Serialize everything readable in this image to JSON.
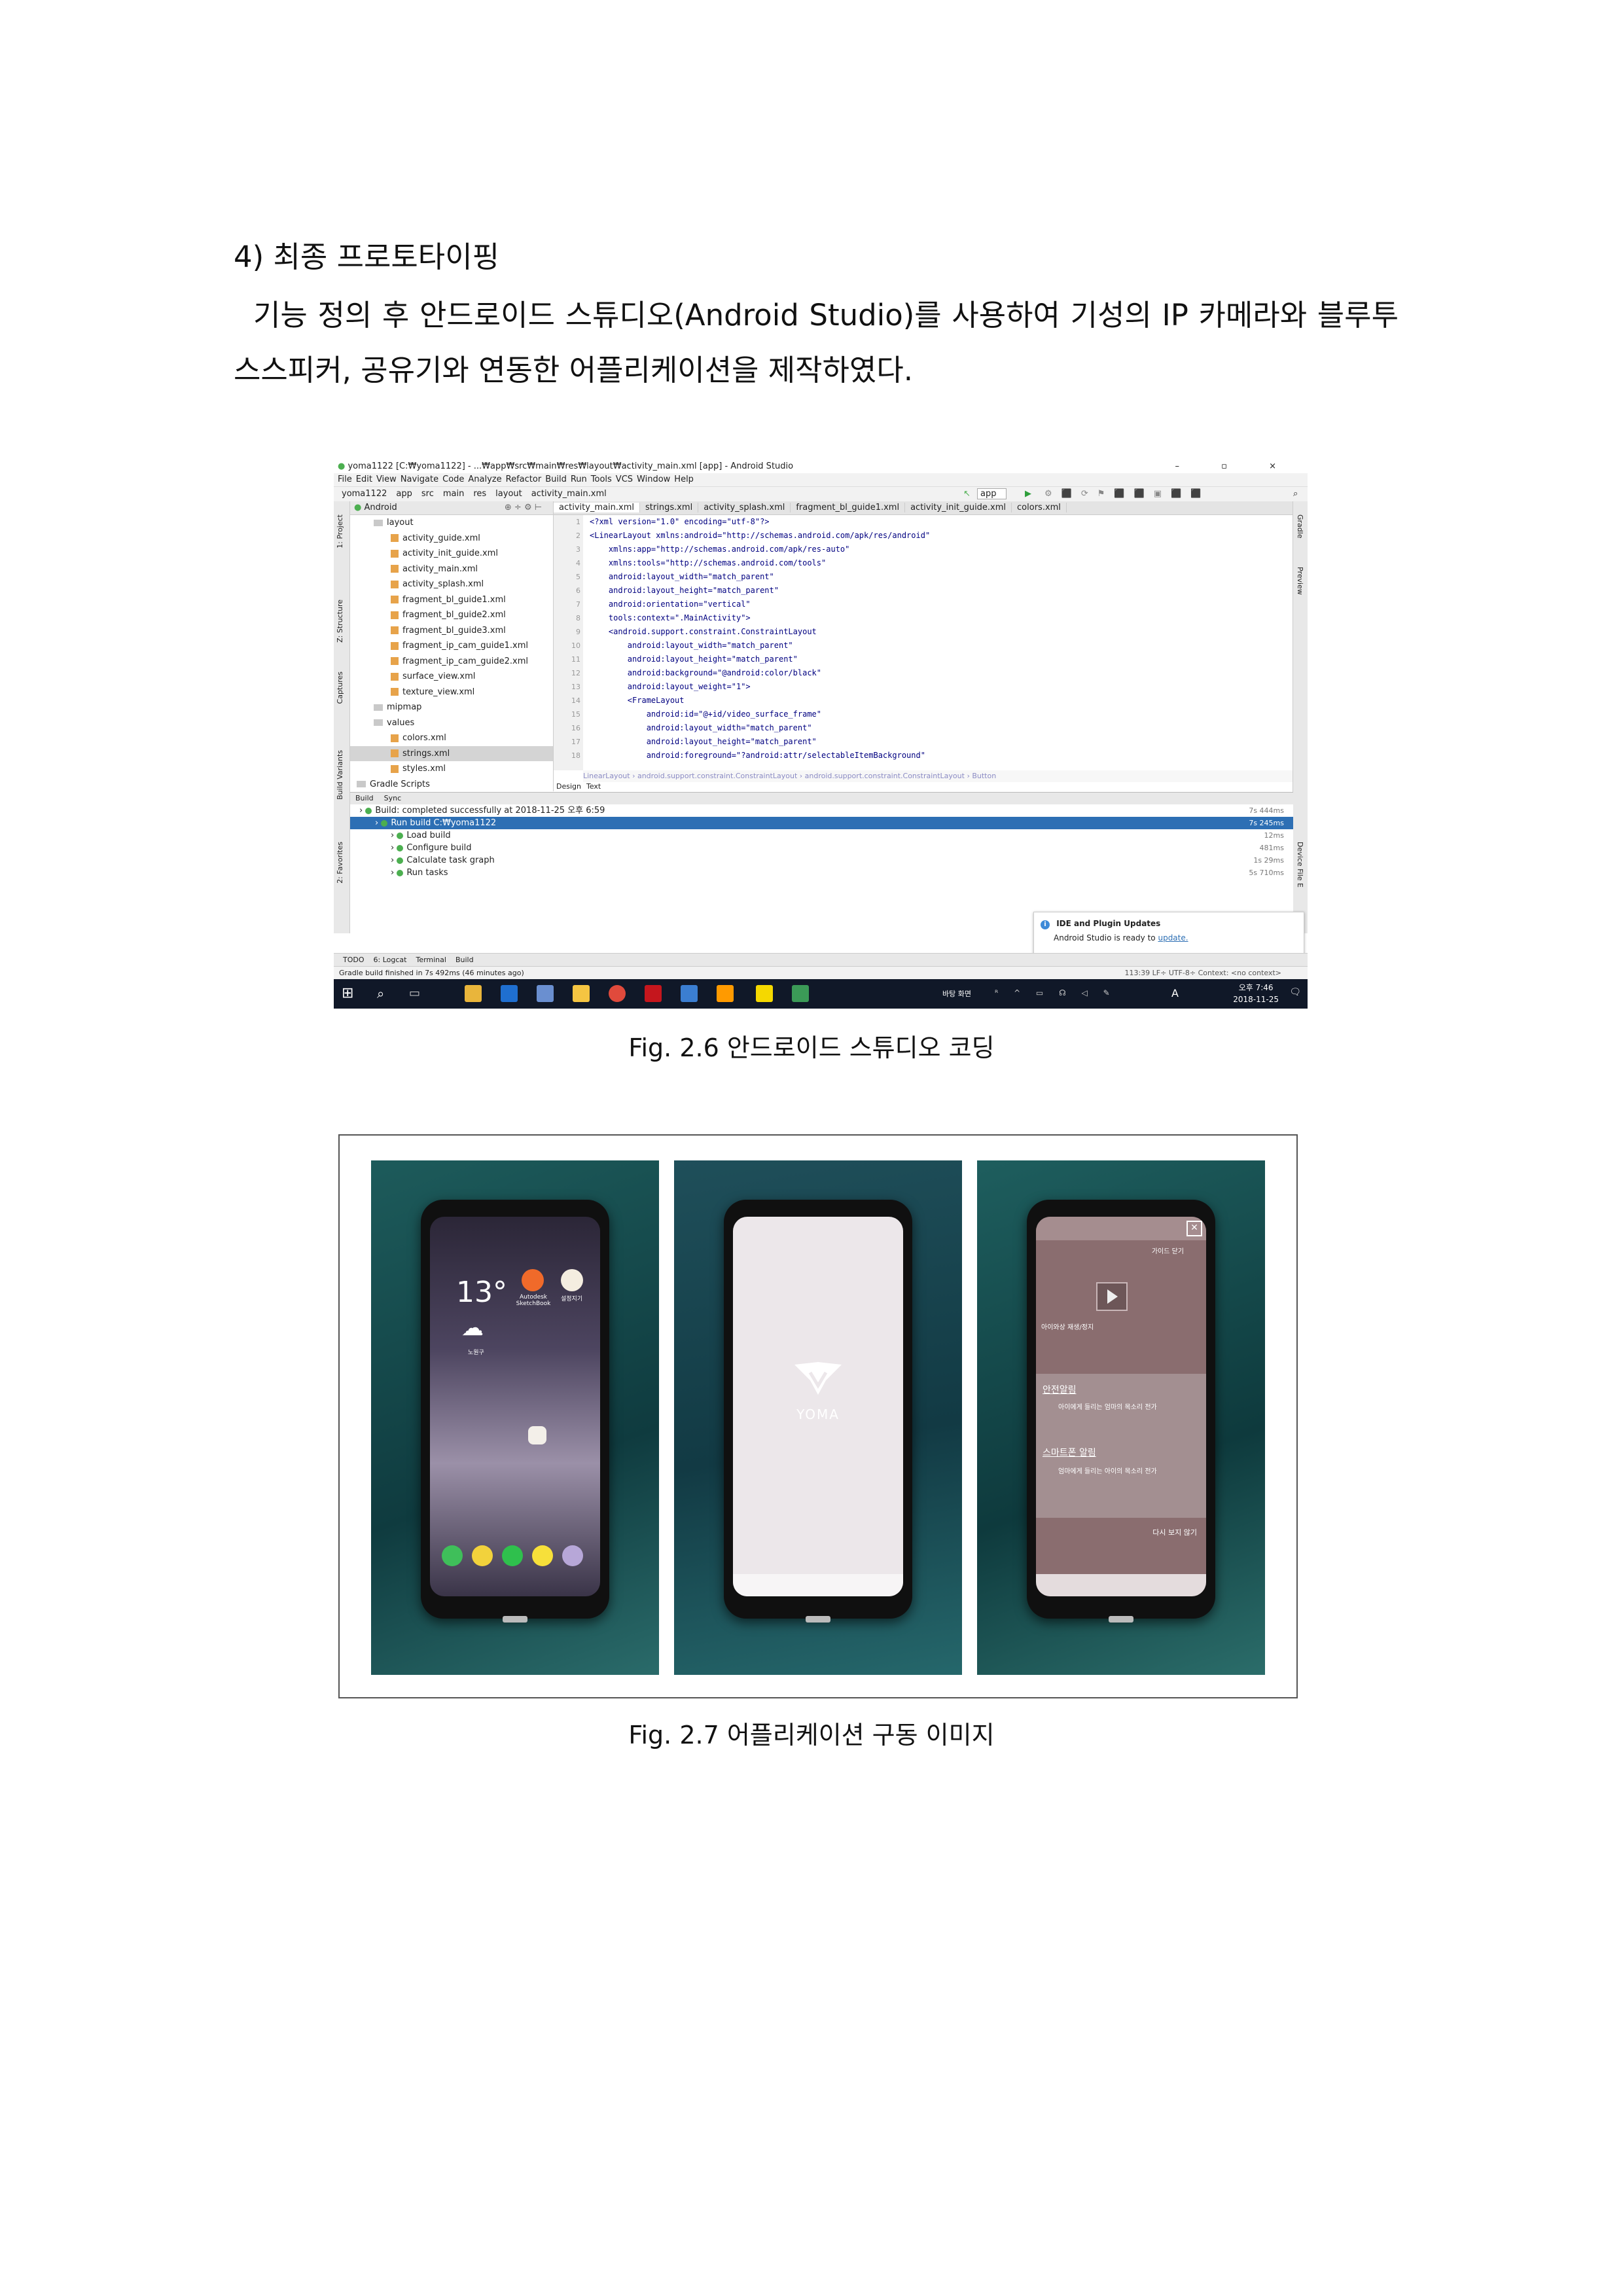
{
  "doc": {
    "heading": "4) 최종 프로토타이핑",
    "paragraph": "기능 정의 후 안드로이드 스튜디오(Android Studio)를 사용하여 기성의 IP 카메라와 블루투스스피커, 공유기와 연동한 어플리케이션을 제작하였다.",
    "fig1_caption": "Fig. 2.6 안드로이드 스튜디오 코딩",
    "fig2_caption": "Fig. 2.7 어플리케이션 구동 이미지"
  },
  "studio": {
    "title": "yoma1122 [C:₩yoma1122] - ...₩app₩src₩main₩res₩layout₩activity_main.xml [app] - Android Studio",
    "window_controls": "–  ▫  ×",
    "menu": [
      "File",
      "Edit",
      "View",
      "Navigate",
      "Code",
      "Analyze",
      "Refactor",
      "Build",
      "Run",
      "Tools",
      "VCS",
      "Window",
      "Help"
    ],
    "nav": [
      "yoma1122",
      "app",
      "src",
      "main",
      "res",
      "layout",
      "activity_main.xml"
    ],
    "run_config": "app",
    "project_view": "Android",
    "left_tools": [
      "1: Project",
      "Z: Structure",
      "Captures",
      "Build Variants",
      "2: Favorites"
    ],
    "right_tools": [
      "Gradle",
      "Preview",
      "Device File E"
    ],
    "tree": [
      {
        "label": "layout",
        "type": "folder",
        "indent": 1
      },
      {
        "label": "activity_guide.xml",
        "type": "file",
        "indent": 2
      },
      {
        "label": "activity_init_guide.xml",
        "type": "file",
        "indent": 2
      },
      {
        "label": "activity_main.xml",
        "type": "file",
        "indent": 2
      },
      {
        "label": "activity_splash.xml",
        "type": "file",
        "indent": 2
      },
      {
        "label": "fragment_bl_guide1.xml",
        "type": "file",
        "indent": 2
      },
      {
        "label": "fragment_bl_guide2.xml",
        "type": "file",
        "indent": 2
      },
      {
        "label": "fragment_bl_guide3.xml",
        "type": "file",
        "indent": 2
      },
      {
        "label": "fragment_ip_cam_guide1.xml",
        "type": "file",
        "indent": 2
      },
      {
        "label": "fragment_ip_cam_guide2.xml",
        "type": "file",
        "indent": 2
      },
      {
        "label": "surface_view.xml",
        "type": "file",
        "indent": 2
      },
      {
        "label": "texture_view.xml",
        "type": "file",
        "indent": 2
      },
      {
        "label": "mipmap",
        "type": "folder",
        "indent": 1
      },
      {
        "label": "values",
        "type": "folder",
        "indent": 1
      },
      {
        "label": "colors.xml",
        "type": "file",
        "indent": 2
      },
      {
        "label": "strings.xml",
        "type": "file",
        "indent": 2,
        "selected": true
      },
      {
        "label": "styles.xml",
        "type": "file",
        "indent": 2
      },
      {
        "label": "Gradle Scripts",
        "type": "folder",
        "indent": 0
      }
    ],
    "tabs": [
      "activity_main.xml",
      "strings.xml",
      "activity_splash.xml",
      "fragment_bl_guide1.xml",
      "activity_init_guide.xml",
      "colors.xml"
    ],
    "code": [
      {
        "t": "<?xml version=\"1.0\" encoding=\"utf-8\"?>"
      },
      {
        "t": "<LinearLayout xmlns:android=\"http://schemas.android.com/apk/res/android\""
      },
      {
        "t": "    xmlns:app=\"http://schemas.android.com/apk/res-auto\""
      },
      {
        "t": "    xmlns:tools=\"http://schemas.android.com/tools\""
      },
      {
        "t": "    android:layout_width=\"match_parent\""
      },
      {
        "t": "    android:layout_height=\"match_parent\""
      },
      {
        "t": "    android:orientation=\"vertical\""
      },
      {
        "t": "    tools:context=\".MainActivity\">"
      },
      {
        "t": "    <android.support.constraint.ConstraintLayout"
      },
      {
        "t": "        android:layout_width=\"match_parent\""
      },
      {
        "t": "        android:layout_height=\"match_parent\""
      },
      {
        "t": "        android:background=\"@android:color/black\""
      },
      {
        "t": "        android:layout_weight=\"1\">"
      },
      {
        "t": "        <FrameLayout"
      },
      {
        "t": "            android:id=\"@+id/video_surface_frame\""
      },
      {
        "t": "            android:layout_width=\"match_parent\""
      },
      {
        "t": "            android:layout_height=\"match_parent\""
      },
      {
        "t": "            android:foreground=\"?android:attr/selectableItemBackground\""
      }
    ],
    "line_numbers": [
      "1",
      "2",
      "3",
      "4",
      "5",
      "6",
      "7",
      "8",
      "9",
      "10",
      "11",
      "12",
      "13",
      "14",
      "15",
      "16",
      "17",
      "18"
    ],
    "breadcrumb": "LinearLayout  ›  android.support.constraint.ConstraintLayout  ›  android.support.constraint.ConstraintLayout  ›  Button",
    "design_tabs": [
      "Design",
      "Text"
    ],
    "build_tabs": [
      "Build",
      "Sync"
    ],
    "build_lines": [
      {
        "label": "Build: completed successfully   at 2018-11-25 오후 6:59",
        "time": "7s 444ms",
        "indent": 0,
        "sel": false
      },
      {
        "label": "Run build  C:₩yoma1122",
        "time": "7s 245ms",
        "indent": 1,
        "sel": true
      },
      {
        "label": "Load build",
        "time": "12ms",
        "indent": 2,
        "sel": false
      },
      {
        "label": "Configure build",
        "time": "481ms",
        "indent": 2,
        "sel": false
      },
      {
        "label": "Calculate task graph",
        "time": "1s 29ms",
        "indent": 2,
        "sel": false
      },
      {
        "label": "Run tasks",
        "time": "5s 710ms",
        "indent": 2,
        "sel": false
      }
    ],
    "popup_title": "IDE and Plugin Updates",
    "popup_text": "Android Studio is ready to",
    "popup_link": "update.",
    "tool_windows": [
      "TODO",
      "6: Logcat",
      "Terminal",
      "Build"
    ],
    "status_left": "Gradle build finished in 7s 492ms (46 minutes ago)",
    "status_right": "113:39  LF÷  UTF-8÷  Context: <no context>",
    "taskbar_lang": "바탕 화면",
    "taskbar_ime": "A",
    "taskbar_time": "오후 7:46",
    "taskbar_date": "2018-11-25"
  },
  "phones": {
    "home_time": "13°",
    "home_app1": "Autodesk SketchBook",
    "home_app2": "설정지기",
    "home_location": "노원구",
    "splash_brand": "YOMA",
    "guide_top": "가이드 닫기",
    "guide_play_label": "아이와상 재생/정지",
    "guide_sec1": "안전알림",
    "guide_sec1_sub": "아이에게 들리는 엄마의 목소리 전가",
    "guide_sec2": "스마트폰 알림",
    "guide_sec2_sub": "엄마에게 들리는 아이의 목소리 전가",
    "guide_bottom": "다시 보지 않기"
  },
  "colors": {
    "brand_green": "#4caf50",
    "selection_blue": "#2d6fb4"
  }
}
